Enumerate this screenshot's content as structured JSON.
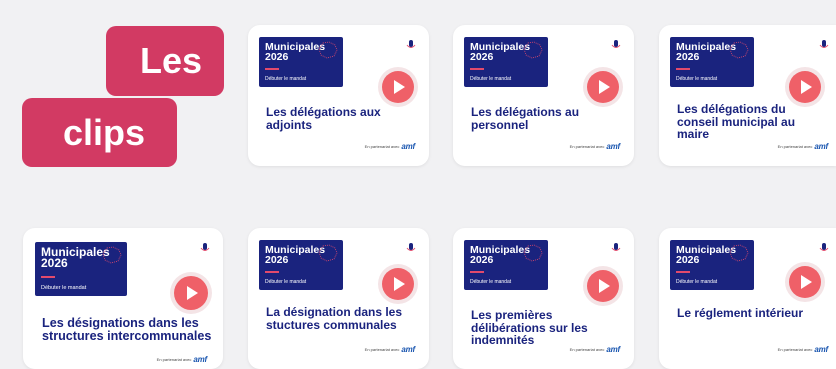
{
  "header": {
    "tag_line1": "Les",
    "tag_line2": "clips"
  },
  "banner": {
    "title1": "Municipales",
    "title2": "2026",
    "subtitle": "Débuter le mandat"
  },
  "partner": {
    "prefix": "En partenariat avec",
    "brand": "amf"
  },
  "clips": [
    {
      "title": "Les délégations aux adjoints"
    },
    {
      "title": "Les délégations au personnel"
    },
    {
      "title": "Les délégations du conseil municipal au maire"
    },
    {
      "title": "Les désignations dans les structures intercommunales"
    },
    {
      "title": "La désignation dans les stuctures communales"
    },
    {
      "title": "Les premières délibérations sur les indemnités"
    },
    {
      "title": "Le réglement intérieur"
    }
  ],
  "colors": {
    "accent": "#d23a63",
    "navy": "#1a237e",
    "play": "#ef6068"
  }
}
